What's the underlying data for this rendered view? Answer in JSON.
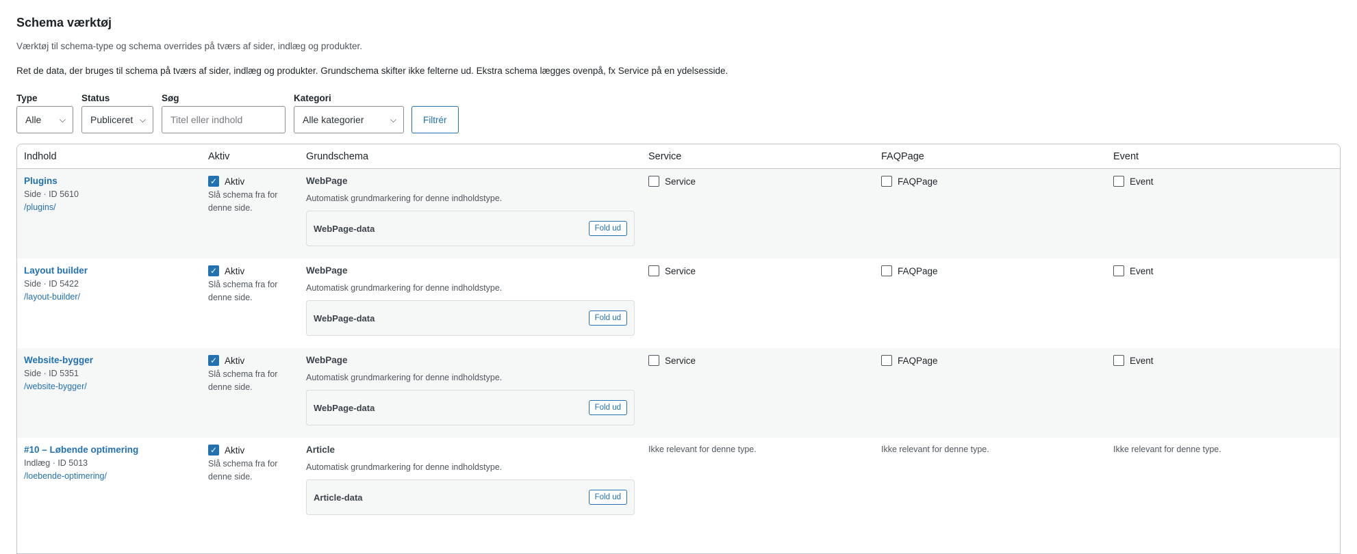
{
  "page": {
    "title": "Schema værktøj",
    "subtitle": "Værktøj til schema-type og schema overrides på tværs af sider, indlæg og produkter.",
    "description": "Ret de data, der bruges til schema på tværs af sider, indlæg og produkter. Grundschema skifter ikke felterne ud. Ekstra schema lægges ovenpå, fx Service på en ydelsesside."
  },
  "filters": {
    "type_label": "Type",
    "type_value": "Alle",
    "status_label": "Status",
    "status_value": "Publiceret",
    "search_label": "Søg",
    "search_placeholder": "Titel eller indhold",
    "category_label": "Kategori",
    "category_value": "Alle kategorier",
    "filter_button": "Filtrér"
  },
  "table": {
    "headers": [
      "Indhold",
      "Aktiv",
      "Grundschema",
      "Service",
      "FAQPage",
      "Event"
    ],
    "rows": [
      {
        "title": "Plugins",
        "meta": "Side · ID 5610",
        "slug": "/plugins/",
        "active_label": "Aktiv",
        "active_checked": true,
        "active_note": "Slå schema fra for denne side.",
        "schema_type": "WebPage",
        "schema_note": "Automatisk grundmarkering for denne indholdstype.",
        "schema_box": "WebPage-data",
        "expand": "Fold ud",
        "service": "Service",
        "faq": "FAQPage",
        "event": "Event"
      },
      {
        "title": "Layout builder",
        "meta": "Side · ID 5422",
        "slug": "/layout-builder/",
        "active_label": "Aktiv",
        "active_checked": true,
        "active_note": "Slå schema fra for denne side.",
        "schema_type": "WebPage",
        "schema_note": "Automatisk grundmarkering for denne indholdstype.",
        "schema_box": "WebPage-data",
        "expand": "Fold ud",
        "service": "Service",
        "faq": "FAQPage",
        "event": "Event"
      },
      {
        "title": "Website-bygger",
        "meta": "Side · ID 5351",
        "slug": "/website-bygger/",
        "active_label": "Aktiv",
        "active_checked": true,
        "active_note": "Slå schema fra for denne side.",
        "schema_type": "WebPage",
        "schema_note": "Automatisk grundmarkering for denne indholdstype.",
        "schema_box": "WebPage-data",
        "expand": "Fold ud",
        "service": "Service",
        "faq": "FAQPage",
        "event": "Event"
      },
      {
        "title": "#10 – Løbende optimering",
        "meta": "Indlæg · ID 5013",
        "slug": "/loebende-optimering/",
        "active_label": "Aktiv",
        "active_checked": true,
        "active_note": "Slå schema fra for denne side.",
        "schema_type": "Article",
        "schema_note": "Automatisk grundmarkering for denne indholdstype.",
        "schema_box": "Article-data",
        "expand": "Fold ud",
        "na_text": "Ikke relevant for denne type."
      }
    ]
  },
  "colors": {
    "accent": "#2271b1",
    "row_alt": "#f6f7f7",
    "border": "#c3c4c7"
  }
}
